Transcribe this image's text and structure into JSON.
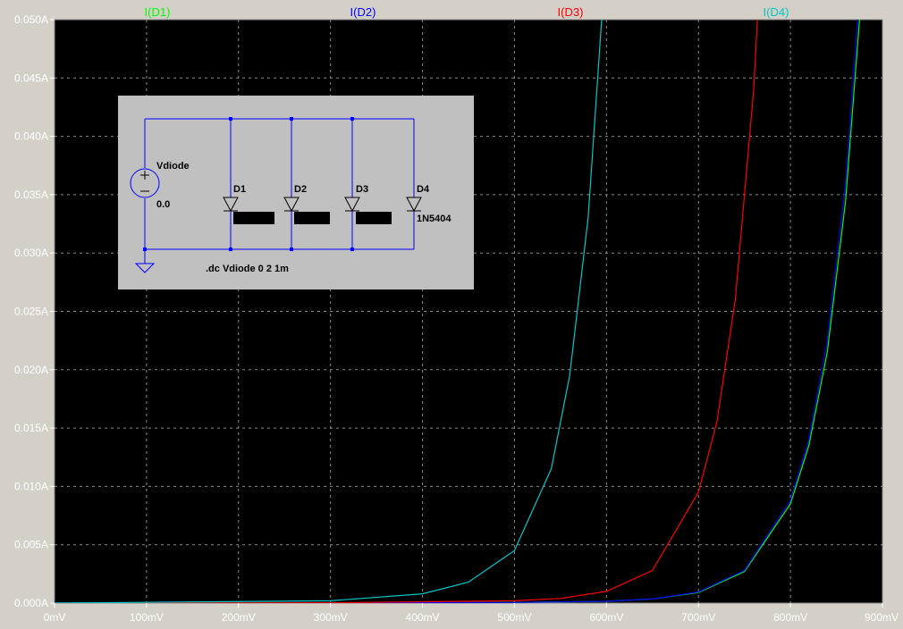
{
  "chart_data": {
    "type": "line",
    "xlabel": "",
    "ylabel": "",
    "xlim": [
      0,
      0.9
    ],
    "ylim": [
      0,
      0.05
    ],
    "x_ticks": [
      {
        "value": 0.0,
        "label": "0mV"
      },
      {
        "value": 0.1,
        "label": "100mV"
      },
      {
        "value": 0.2,
        "label": "200mV"
      },
      {
        "value": 0.3,
        "label": "300mV"
      },
      {
        "value": 0.4,
        "label": "400mV"
      },
      {
        "value": 0.5,
        "label": "500mV"
      },
      {
        "value": 0.6,
        "label": "600mV"
      },
      {
        "value": 0.7,
        "label": "700mV"
      },
      {
        "value": 0.8,
        "label": "800mV"
      },
      {
        "value": 0.9,
        "label": "900mV"
      }
    ],
    "y_ticks": [
      {
        "value": 0.0,
        "label": "0.000A"
      },
      {
        "value": 0.005,
        "label": "0.005A"
      },
      {
        "value": 0.01,
        "label": "0.010A"
      },
      {
        "value": 0.015,
        "label": "0.015A"
      },
      {
        "value": 0.02,
        "label": "0.020A"
      },
      {
        "value": 0.025,
        "label": "0.025A"
      },
      {
        "value": 0.03,
        "label": "0.030A"
      },
      {
        "value": 0.035,
        "label": "0.035A"
      },
      {
        "value": 0.04,
        "label": "0.040A"
      },
      {
        "value": 0.045,
        "label": "0.045A"
      },
      {
        "value": 0.05,
        "label": "0.050A"
      }
    ],
    "grid": true,
    "legend_placement": "top",
    "background": "#000000",
    "grid_color": "#8a8a8a",
    "series": [
      {
        "name": "I(D1)",
        "color": "#00ff00",
        "x": [
          0.0,
          0.3,
          0.5,
          0.6,
          0.65,
          0.7,
          0.75,
          0.8,
          0.82,
          0.84,
          0.86,
          0.88,
          0.9
        ],
        "y": [
          0.0,
          1e-05,
          5e-05,
          0.00015,
          0.00035,
          0.0009,
          0.0027,
          0.0085,
          0.0135,
          0.0215,
          0.0345,
          0.055,
          0.088
        ]
      },
      {
        "name": "I(D2)",
        "color": "#0000ff",
        "x": [
          0.0,
          0.3,
          0.5,
          0.6,
          0.65,
          0.7,
          0.75,
          0.8,
          0.82,
          0.84,
          0.86,
          0.88,
          0.9
        ],
        "y": [
          0.0,
          1e-05,
          5e-05,
          0.00015,
          0.00035,
          0.00095,
          0.0028,
          0.0088,
          0.014,
          0.0225,
          0.036,
          0.0575,
          0.092
        ]
      },
      {
        "name": "I(D3)",
        "color": "#ff0000",
        "x": [
          0.0,
          0.3,
          0.5,
          0.55,
          0.6,
          0.65,
          0.7,
          0.72,
          0.74,
          0.76,
          0.78
        ],
        "y": [
          0.0,
          2e-05,
          0.0002,
          0.0004,
          0.001,
          0.0028,
          0.0095,
          0.0155,
          0.026,
          0.044,
          0.074
        ]
      },
      {
        "name": "I(D4)",
        "color": "#00c8c8",
        "x": [
          0.0,
          0.3,
          0.4,
          0.45,
          0.5,
          0.54,
          0.56,
          0.58,
          0.6,
          0.62
        ],
        "y": [
          0.0,
          0.0002,
          0.0008,
          0.0018,
          0.0045,
          0.0115,
          0.0195,
          0.033,
          0.056,
          0.094
        ]
      }
    ]
  },
  "schematic": {
    "source_name": "Vdiode",
    "source_value": "0.0",
    "diode_labels": [
      "D1",
      "D2",
      "D3",
      "D4"
    ],
    "diode_model": "1N5404",
    "directive": ".dc Vdiode 0 2 1m",
    "panel_color": "#c0c0c0",
    "wire_color": "#0000ff"
  }
}
